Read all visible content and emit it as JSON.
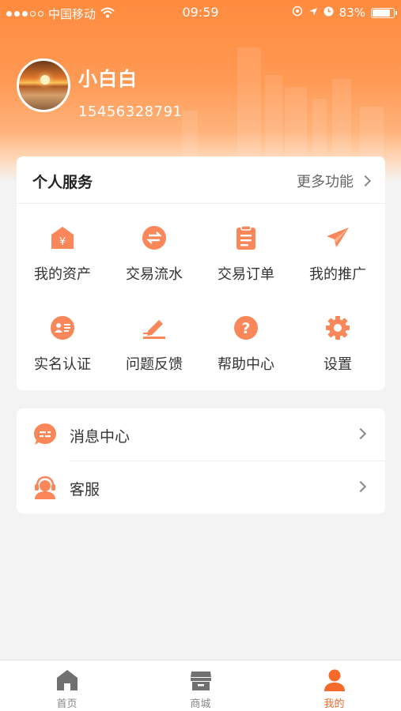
{
  "status_bar": {
    "carrier": "中国移动",
    "time": "09:59",
    "battery_text": "83%",
    "battery_level": 0.83,
    "signal_icon": "signal-dots-icon",
    "wifi_icon": "wifi-icon"
  },
  "profile": {
    "name": "小白白",
    "phone": "15456328791"
  },
  "services": {
    "title": "个人服务",
    "more_label": "更多功能",
    "items": [
      {
        "label": "我的资产",
        "icon": "assets-icon"
      },
      {
        "label": "交易流水",
        "icon": "transactions-icon"
      },
      {
        "label": "交易订单",
        "icon": "orders-icon"
      },
      {
        "label": "我的推广",
        "icon": "promotion-icon"
      },
      {
        "label": "实名认证",
        "icon": "verification-icon"
      },
      {
        "label": "问题反馈",
        "icon": "feedback-icon"
      },
      {
        "label": "帮助中心",
        "icon": "help-icon"
      },
      {
        "label": "设置",
        "icon": "settings-icon"
      }
    ]
  },
  "list": {
    "items": [
      {
        "label": "消息中心",
        "icon": "message-icon"
      },
      {
        "label": "客服",
        "icon": "customer-service-icon"
      }
    ]
  },
  "tabbar": {
    "items": [
      {
        "label": "首页",
        "icon": "home-icon"
      },
      {
        "label": "商城",
        "icon": "store-icon"
      },
      {
        "label": "我的",
        "icon": "user-icon"
      }
    ],
    "active_index": 2
  },
  "colors": {
    "accent": "#f56a2a",
    "icon_orange": "#f9875a",
    "header_gradient_top": "#ff8a3d"
  }
}
